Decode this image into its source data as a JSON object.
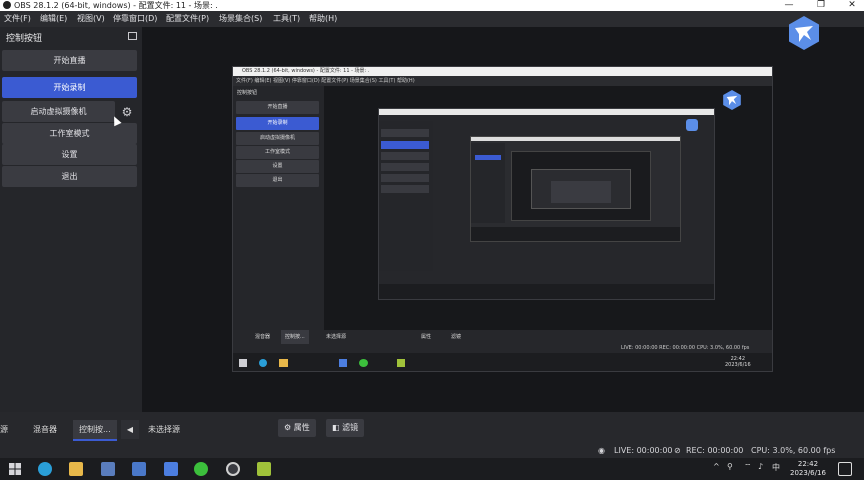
{
  "window": {
    "title": "OBS 28.1.2 (64-bit, windows) - 配置文件: 11 - 场景: .",
    "minimize": "—",
    "maximize": "❐",
    "close": "✕"
  },
  "menu": [
    "文件(F)",
    "编辑(E)",
    "视图(V)",
    "停靠窗口(D)",
    "配置文件(P)",
    "场景集合(S)",
    "工具(T)",
    "帮助(H)"
  ],
  "controls_dock": {
    "title": "控制按钮",
    "buttons": [
      "开始直播",
      "开始录制",
      "启动虚拟摄像机",
      "工作室模式",
      "设置",
      "退出"
    ]
  },
  "nested_preview": {
    "title": "OBS 28.1.2 (64-bit, windows) - 配置文件: 11 - 场景: .",
    "menu": "文件(F)   编辑(E)   视图(V)   停靠窗口(D)   配置文件(P)   场景集合(S)   工具(T)   帮助(H)",
    "dock_title": "控制按钮",
    "buttons": [
      "开始直播",
      "开始录制",
      "启动虚拟摄像机",
      "工作室模式",
      "设置",
      "退出"
    ],
    "tabs": [
      "混音器",
      "控制按...",
      "未选择源",
      "属性",
      "滤镜"
    ],
    "status": "LIVE: 00:00:00   REC: 00:00:00   CPU: 3.0%, 60.00 fps",
    "clock_time": "22:42",
    "clock_date": "2023/6/16"
  },
  "bottom_tabs": {
    "left_edge": "源",
    "mixer": "混音器",
    "controls": "控制按...",
    "arrow": "◀",
    "no_source": "未选择源",
    "properties": "属性",
    "filters": "滤镜"
  },
  "status": {
    "live": "LIVE: 00:00:00",
    "rec": "REC: 00:00:00",
    "cpu": "CPU: 3.0%, 60.00 fps"
  },
  "taskbar": {
    "tray_chevron": "^",
    "lang": "中",
    "time": "22:42",
    "date": "2023/6/16"
  },
  "colors": {
    "accent": "#3b5bd2",
    "background": "#1e1f22",
    "panel": "#25262a",
    "button": "#3a3b41"
  },
  "icons": [
    "obs-icon",
    "undock-icon",
    "gear-icon",
    "obs-logo-icon",
    "windows-start-icon",
    "edge-icon",
    "file-explorer-icon",
    "wechat-icon",
    "obs-taskbar-icon",
    "android-icon"
  ]
}
